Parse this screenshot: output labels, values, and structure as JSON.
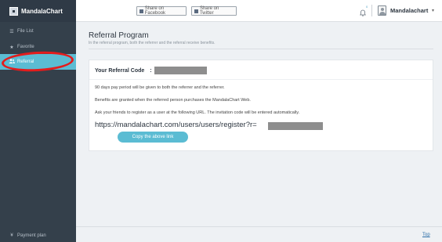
{
  "header": {
    "brand_name": "MandalaChart",
    "share_facebook_label": "Share on Facebook",
    "share_twitter_label": "Share on Twitter",
    "notification_count": "0",
    "username": "Mandalachart",
    "user_menu_caret": "▾"
  },
  "sidebar": {
    "items": [
      {
        "label": "File List",
        "icon": "list-icon",
        "glyph": "☰"
      },
      {
        "label": "Favorite",
        "icon": "star-icon",
        "glyph": "★"
      },
      {
        "label": "Referral",
        "icon": "users-icon",
        "glyph": "👥",
        "active": true
      }
    ],
    "footer": {
      "label": "Payment plan",
      "icon": "yen-icon",
      "glyph": "¥"
    }
  },
  "main": {
    "title": "Referral Program",
    "subtitle": "In the referral program, both the referrer and the referral receive benefits.",
    "card": {
      "code_label": "Your Referral Code　:",
      "line1": "90 days pay period will be given to both the referrer and the referrer.",
      "line2": "Benefits are granted when the referred person purchases the MandalaChart Web.",
      "line3": "Ask your friends to register as a user at the following URL. The invitation code will be entered automatically.",
      "url": "https://mandalachart.com/users/users/register?r=",
      "copy_button": "Copy the above link"
    }
  },
  "footer": {
    "top_link": "Top"
  },
  "colors": {
    "accent": "#5bbcd3",
    "sidebar": "#34404b",
    "annotation": "#e31c1c"
  }
}
